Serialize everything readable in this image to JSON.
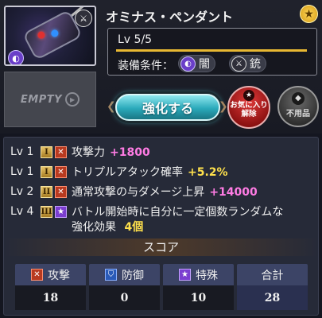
{
  "item": {
    "name": "オミナス・ペンダント",
    "level_text": "Lv 5/5",
    "level_progress": 1.0,
    "equip_label": "装備条件：",
    "conditions": [
      {
        "icon": "dark-element-icon",
        "label": "闇",
        "color": "#6a3fc8"
      },
      {
        "icon": "gun-icon",
        "label": "銃",
        "color": "#2f2f3a"
      }
    ],
    "favorite_star_icon": "star-icon"
  },
  "slot": {
    "empty_label": "EMPTY",
    "empty_icon": "play-icon"
  },
  "buttons": {
    "enhance": "強化する",
    "favorite_release_line1": "お気に入り",
    "favorite_release_line2": "解除",
    "unused": "不用品"
  },
  "skills": [
    {
      "lv": "Lv 1",
      "rank": "I",
      "type_icon": "attack-icon",
      "text": "攻撃力",
      "value": "+1800",
      "value_color": "pink"
    },
    {
      "lv": "Lv 1",
      "rank": "I",
      "type_icon": "attack-icon",
      "text": "トリプルアタック確率",
      "value": "+5.2%",
      "value_color": "yellow"
    },
    {
      "lv": "Lv 2",
      "rank": "II",
      "type_icon": "attack-icon",
      "text": "通常攻撃の与ダメージ上昇",
      "value": "+14000",
      "value_color": "pink"
    },
    {
      "lv": "Lv 4",
      "rank": "III",
      "type_icon": "special-icon",
      "text_line1": "バトル開始時に自分に一定個数ランダムな",
      "text_line2": "強化効果",
      "value": "4個",
      "value_color": "yellow"
    }
  ],
  "score": {
    "title": "スコア",
    "columns": [
      {
        "label": "攻撃",
        "icon": "attack-icon",
        "value": "18"
      },
      {
        "label": "防御",
        "icon": "defense-icon",
        "value": "0"
      },
      {
        "label": "特殊",
        "icon": "special-icon",
        "value": "10"
      },
      {
        "label": "合計",
        "value": "28"
      }
    ]
  },
  "colors": {
    "accent_pink": "#ff7ce4",
    "accent_yellow": "#ffe14c",
    "enhance_button": "#2aa9ba"
  }
}
